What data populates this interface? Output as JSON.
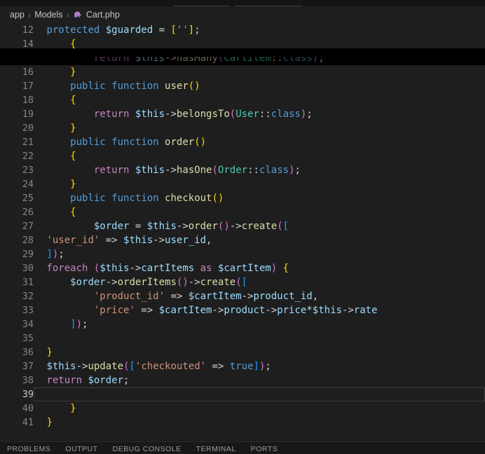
{
  "breadcrumb": {
    "items": [
      "app",
      "Models",
      "Cart.php"
    ],
    "separator": "›"
  },
  "palette": {
    "editor_bg": "#1e1e1e",
    "strip_bg": "#141414",
    "panel_bg": "#181818",
    "gutter": "#858585",
    "gutter_current": "#c6c6c6",
    "artifact_band": "#000000",
    "tokens": {
      "default": "#d4d4d4",
      "kw": "#569cd6",
      "ctrl": "#c586c0",
      "var": "#9cdcfe",
      "fn": "#dcdcaa",
      "cls": "#4ec9b0",
      "str": "#ce9178",
      "b1": "#ffd700",
      "b2": "#da70d6",
      "b3": "#179fff"
    }
  },
  "editor": {
    "lines": [
      {
        "n": "12",
        "tokens": [
          [
            " ",
            ""
          ],
          [
            "protected",
            "kw"
          ],
          [
            " ",
            ""
          ],
          [
            "$guarded",
            "var"
          ],
          [
            " = ",
            ""
          ],
          [
            "[",
            "b1"
          ],
          [
            "''",
            "str"
          ],
          [
            "]",
            "b1"
          ],
          [
            ";",
            ""
          ]
        ]
      },
      {
        "n": "14",
        "tokens": [
          [
            "     ",
            ""
          ],
          [
            "{",
            "b1"
          ]
        ]
      },
      {
        "n": "",
        "flag": "artifact",
        "tokens": [
          [
            "         ",
            ""
          ],
          [
            "return",
            "ctrl"
          ],
          [
            " ",
            ""
          ],
          [
            "$this",
            "var"
          ],
          [
            "->",
            ""
          ],
          [
            "hasMany",
            "fn"
          ],
          [
            "(",
            "b2"
          ],
          [
            "CartItem",
            "cls"
          ],
          [
            "::",
            ""
          ],
          [
            "class",
            "kw"
          ],
          [
            ")",
            "b2"
          ],
          [
            ";",
            ""
          ]
        ]
      },
      {
        "n": "16",
        "tokens": [
          [
            "     ",
            ""
          ],
          [
            "}",
            "b1"
          ]
        ]
      },
      {
        "n": "17",
        "tokens": [
          [
            "     ",
            ""
          ],
          [
            "public",
            "kw"
          ],
          [
            " ",
            ""
          ],
          [
            "function",
            "kw"
          ],
          [
            " ",
            ""
          ],
          [
            "user",
            "fn"
          ],
          [
            "()",
            "b1"
          ]
        ]
      },
      {
        "n": "18",
        "tokens": [
          [
            "     ",
            ""
          ],
          [
            "{",
            "b1"
          ]
        ]
      },
      {
        "n": "19",
        "tokens": [
          [
            "         ",
            ""
          ],
          [
            "return",
            "ctrl"
          ],
          [
            " ",
            ""
          ],
          [
            "$this",
            "var"
          ],
          [
            "->",
            ""
          ],
          [
            "belongsTo",
            "fn"
          ],
          [
            "(",
            "b2"
          ],
          [
            "User",
            "cls"
          ],
          [
            "::",
            ""
          ],
          [
            "class",
            "kw"
          ],
          [
            ")",
            "b2"
          ],
          [
            ";",
            ""
          ]
        ]
      },
      {
        "n": "20",
        "tokens": [
          [
            "     ",
            ""
          ],
          [
            "}",
            "b1"
          ]
        ]
      },
      {
        "n": "21",
        "tokens": [
          [
            "     ",
            ""
          ],
          [
            "public",
            "kw"
          ],
          [
            " ",
            ""
          ],
          [
            "function",
            "kw"
          ],
          [
            " ",
            ""
          ],
          [
            "order",
            "fn"
          ],
          [
            "()",
            "b1"
          ]
        ]
      },
      {
        "n": "22",
        "tokens": [
          [
            "     ",
            ""
          ],
          [
            "{",
            "b1"
          ]
        ]
      },
      {
        "n": "23",
        "tokens": [
          [
            "         ",
            ""
          ],
          [
            "return",
            "ctrl"
          ],
          [
            " ",
            ""
          ],
          [
            "$this",
            "var"
          ],
          [
            "->",
            ""
          ],
          [
            "hasOne",
            "fn"
          ],
          [
            "(",
            "b2"
          ],
          [
            "Order",
            "cls"
          ],
          [
            "::",
            ""
          ],
          [
            "class",
            "kw"
          ],
          [
            ")",
            "b2"
          ],
          [
            ";",
            ""
          ]
        ]
      },
      {
        "n": "24",
        "tokens": [
          [
            "     ",
            ""
          ],
          [
            "}",
            "b1"
          ]
        ]
      },
      {
        "n": "25",
        "tokens": [
          [
            "     ",
            ""
          ],
          [
            "public",
            "kw"
          ],
          [
            " ",
            ""
          ],
          [
            "function",
            "kw"
          ],
          [
            " ",
            ""
          ],
          [
            "checkout",
            "fn"
          ],
          [
            "()",
            "b1"
          ]
        ]
      },
      {
        "n": "26",
        "tokens": [
          [
            "     ",
            ""
          ],
          [
            "{",
            "b1"
          ]
        ]
      },
      {
        "n": "27",
        "tokens": [
          [
            "         ",
            ""
          ],
          [
            "$order",
            "var"
          ],
          [
            " = ",
            ""
          ],
          [
            "$this",
            "var"
          ],
          [
            "->",
            ""
          ],
          [
            "order",
            "fn"
          ],
          [
            "()",
            "b2"
          ],
          [
            "->",
            ""
          ],
          [
            "create",
            "fn"
          ],
          [
            "(",
            "b2"
          ],
          [
            "[",
            "b3"
          ]
        ]
      },
      {
        "n": "28",
        "tokens": [
          [
            " ",
            ""
          ],
          [
            "'user_id'",
            "str"
          ],
          [
            " => ",
            ""
          ],
          [
            "$this",
            "var"
          ],
          [
            "->",
            ""
          ],
          [
            "user_id",
            "var"
          ],
          [
            ",",
            ""
          ]
        ]
      },
      {
        "n": "29",
        "tokens": [
          [
            " ",
            ""
          ],
          [
            "]",
            "b3"
          ],
          [
            ")",
            "b2"
          ],
          [
            ";",
            ""
          ]
        ]
      },
      {
        "n": "30",
        "tokens": [
          [
            " ",
            ""
          ],
          [
            "foreach",
            "ctrl"
          ],
          [
            " ",
            ""
          ],
          [
            "(",
            "b2"
          ],
          [
            "$this",
            "var"
          ],
          [
            "->",
            ""
          ],
          [
            "cartItems",
            "var"
          ],
          [
            " ",
            ""
          ],
          [
            "as",
            "ctrl"
          ],
          [
            " ",
            ""
          ],
          [
            "$cartItem",
            "var"
          ],
          [
            ")",
            "b2"
          ],
          [
            " ",
            ""
          ],
          [
            "{",
            "b1"
          ]
        ]
      },
      {
        "n": "31",
        "tokens": [
          [
            "     ",
            ""
          ],
          [
            "$order",
            "var"
          ],
          [
            "->",
            ""
          ],
          [
            "orderItems",
            "fn"
          ],
          [
            "()",
            "b2"
          ],
          [
            "->",
            ""
          ],
          [
            "create",
            "fn"
          ],
          [
            "(",
            "b2"
          ],
          [
            "[",
            "b3"
          ]
        ]
      },
      {
        "n": "32",
        "tokens": [
          [
            "         ",
            ""
          ],
          [
            "'product_id'",
            "str"
          ],
          [
            " => ",
            ""
          ],
          [
            "$cartItem",
            "var"
          ],
          [
            "->",
            ""
          ],
          [
            "product_id",
            "var"
          ],
          [
            ",",
            ""
          ]
        ]
      },
      {
        "n": "33",
        "tokens": [
          [
            "         ",
            ""
          ],
          [
            "'price'",
            "str"
          ],
          [
            " => ",
            ""
          ],
          [
            "$cartItem",
            "var"
          ],
          [
            "->",
            ""
          ],
          [
            "product",
            "var"
          ],
          [
            "->",
            ""
          ],
          [
            "price",
            "var"
          ],
          [
            "*",
            ""
          ],
          [
            "$this",
            "var"
          ],
          [
            "->",
            ""
          ],
          [
            "rate",
            "var"
          ]
        ]
      },
      {
        "n": "34",
        "tokens": [
          [
            "     ",
            ""
          ],
          [
            "]",
            "b3"
          ],
          [
            ")",
            "b2"
          ],
          [
            ";",
            ""
          ]
        ]
      },
      {
        "n": "35",
        "tokens": []
      },
      {
        "n": "36",
        "tokens": [
          [
            " ",
            ""
          ],
          [
            "}",
            "b1"
          ]
        ]
      },
      {
        "n": "37",
        "tokens": [
          [
            " ",
            ""
          ],
          [
            "$this",
            "var"
          ],
          [
            "->",
            ""
          ],
          [
            "update",
            "fn"
          ],
          [
            "(",
            "b2"
          ],
          [
            "[",
            "b3"
          ],
          [
            "'checkouted'",
            "str"
          ],
          [
            " => ",
            ""
          ],
          [
            "true",
            "kw"
          ],
          [
            "]",
            "b3"
          ],
          [
            ")",
            "b2"
          ],
          [
            ";",
            ""
          ]
        ]
      },
      {
        "n": "38",
        "tokens": [
          [
            " ",
            ""
          ],
          [
            "return",
            "ctrl"
          ],
          [
            " ",
            ""
          ],
          [
            "$order",
            "var"
          ],
          [
            ";",
            ""
          ]
        ]
      },
      {
        "n": "39",
        "flag": "current",
        "tokens": []
      },
      {
        "n": "40",
        "tokens": [
          [
            "     ",
            ""
          ],
          [
            "}",
            "b1"
          ]
        ]
      },
      {
        "n": "41",
        "tokens": [
          [
            " ",
            ""
          ],
          [
            "}",
            "b1"
          ]
        ]
      }
    ]
  },
  "panel": {
    "tabs": [
      "PROBLEMS",
      "OUTPUT",
      "DEBUG CONSOLE",
      "TERMINAL",
      "PORTS"
    ]
  }
}
